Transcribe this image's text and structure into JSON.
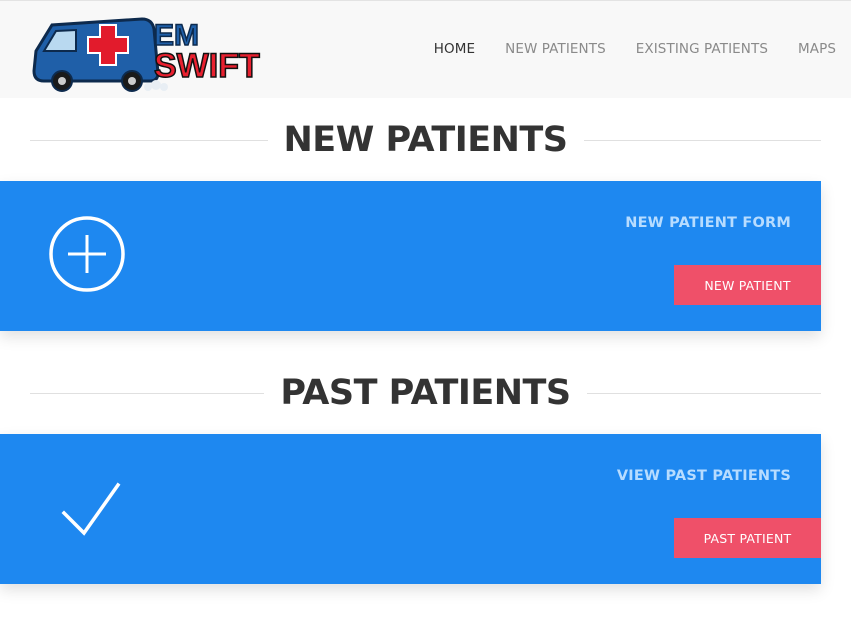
{
  "brand": {
    "logo_text_top": "EM",
    "logo_text_bottom": "SWIFT",
    "colors": {
      "van_blue": "#1f5fa8",
      "cross_red": "#e21b2c",
      "text_red": "#e8202f"
    }
  },
  "nav": {
    "items": [
      {
        "label": "HOME",
        "active": true
      },
      {
        "label": "NEW PATIENTS",
        "active": false
      },
      {
        "label": "EXISTING PATIENTS",
        "active": false
      },
      {
        "label": "MAPS",
        "active": false
      }
    ]
  },
  "sections": {
    "new": {
      "heading": "NEW PATIENTS",
      "panel_title": "NEW PATIENT FORM",
      "button_label": "NEW PATIENT",
      "icon": "plus-circle-icon"
    },
    "past": {
      "heading": "PAST PATIENTS",
      "panel_title": "VIEW PAST PATIENTS",
      "button_label": "PAST PATIENT",
      "icon": "checkmark-icon"
    }
  },
  "colors": {
    "panel_bg": "#1e88f0",
    "panel_title": "#b7dcff",
    "button_bg": "#ef5069",
    "heading": "#333333",
    "header_bg": "#f8f8f8"
  }
}
